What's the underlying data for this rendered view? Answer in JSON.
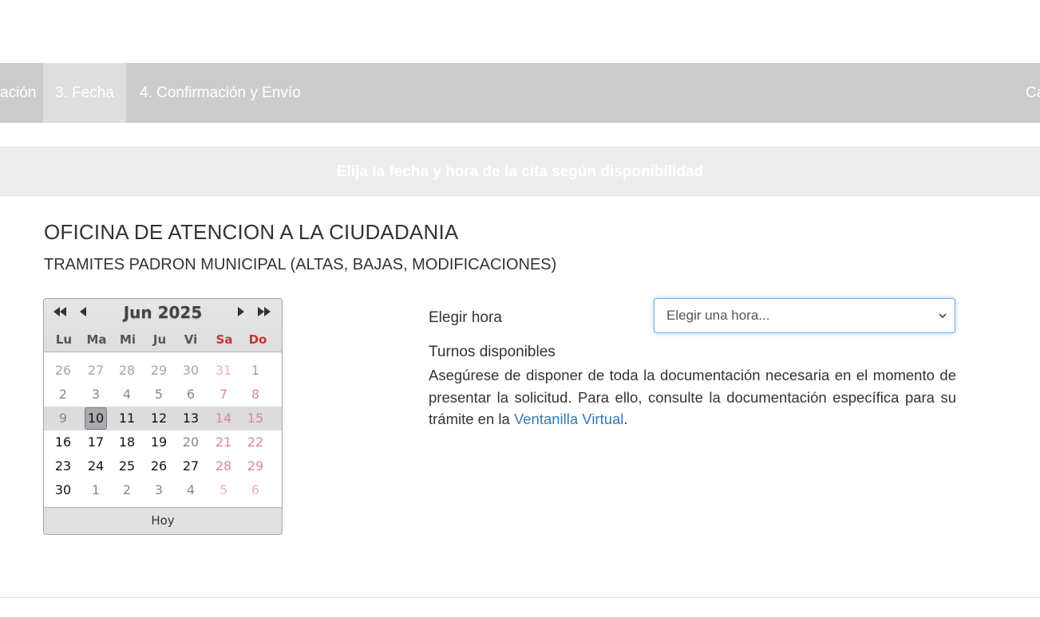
{
  "steps": {
    "prev_step_label": "ación",
    "step3_label": "3. Fecha",
    "step4_label": "4. Confirmación y Envío",
    "right_label": "Ca"
  },
  "banner": {
    "text": "Elija la fecha y hora de la cita según disponibilidad"
  },
  "office": {
    "title": "OFICINA DE ATENCION A LA CIUDADANIA",
    "service": "TRAMITES PADRON MUNICIPAL (ALTAS, BAJAS, MODIFICACIONES)"
  },
  "calendar": {
    "month_label": "Jun 2025",
    "nav_first": "⏮",
    "nav_prev": "◀",
    "nav_next": "▶",
    "nav_last": "⏭",
    "weekdays": [
      "Lu",
      "Ma",
      "Mi",
      "Ju",
      "Vi",
      "Sa",
      "Do"
    ],
    "weeks": [
      [
        "26",
        "27",
        "28",
        "29",
        "30",
        "31",
        "1"
      ],
      [
        "2",
        "3",
        "4",
        "5",
        "6",
        "7",
        "8"
      ],
      [
        "9",
        "10",
        "11",
        "12",
        "13",
        "14",
        "15"
      ],
      [
        "16",
        "17",
        "18",
        "19",
        "20",
        "21",
        "22"
      ],
      [
        "23",
        "24",
        "25",
        "26",
        "27",
        "28",
        "29"
      ],
      [
        "30",
        "1",
        "2",
        "3",
        "4",
        "5",
        "6"
      ]
    ],
    "selected_day": "10",
    "today_button": "Hoy"
  },
  "hour": {
    "label": "Elegir hora",
    "select_value": "Elegir una hora...",
    "chevron_icon": "chevron-down-icon"
  },
  "info": {
    "turnos_label": "Turnos disponibles",
    "notice_text": "Asegúrese de disponer de toda la documentación necesaria en el momento de presentar la solicitud. Para ello, consulte la documentación específica para su trámite en la ",
    "notice_link": "Ventanilla Virtual",
    "notice_end": "."
  },
  "colors": {
    "steps_bg": "#cccccc",
    "step_active_bg": "#dedede",
    "banner_bg": "#ededed",
    "link": "#337ab7",
    "weekend": "#c9444e",
    "focus_border": "#66afe9"
  }
}
